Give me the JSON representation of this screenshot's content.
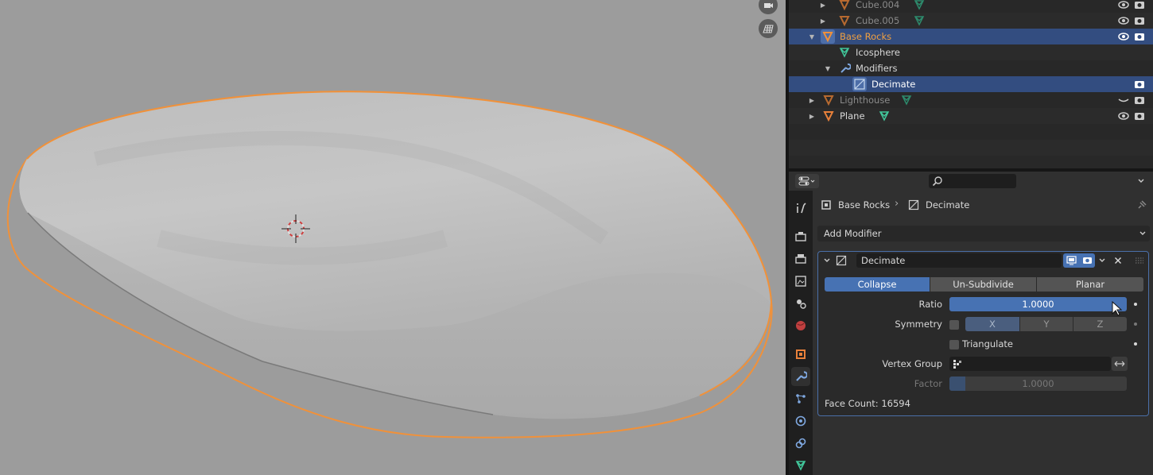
{
  "outliner": {
    "rows": [
      {
        "label": "Cube.004",
        "state": "dim"
      },
      {
        "label": "Cube.005",
        "state": "dim"
      },
      {
        "label": "Base Rocks",
        "state": "selected-active"
      },
      {
        "label": "Icosphere",
        "state": "child"
      },
      {
        "label": "Modifiers",
        "state": "child"
      },
      {
        "label": "Decimate",
        "state": "selected"
      },
      {
        "label": "Lighthouse",
        "state": "dim"
      },
      {
        "label": "Plane",
        "state": "normal"
      }
    ]
  },
  "properties": {
    "search_placeholder": "",
    "breadcrumb": {
      "object": "Base Rocks",
      "modifier": "Decimate"
    },
    "add_modifier_label": "Add Modifier",
    "modifier": {
      "name": "Decimate",
      "modes": [
        "Collapse",
        "Un-Subdivide",
        "Planar"
      ],
      "active_mode": "Collapse",
      "ratio_label": "Ratio",
      "ratio_value": "1.0000",
      "symmetry_label": "Symmetry",
      "symmetry_checked": false,
      "axes": [
        "X",
        "Y",
        "Z"
      ],
      "active_axis": "X",
      "triangulate_label": "Triangulate",
      "triangulate_checked": false,
      "vertex_group_label": "Vertex Group",
      "vertex_group_value": "",
      "factor_label": "Factor",
      "factor_value": "1.0000",
      "face_count": "Face Count: 16594"
    }
  },
  "colors": {
    "accent": "#4772b3",
    "selection": "#334d80",
    "outline": "#f2932d",
    "mesh_green": "#41c79b",
    "object_orange": "#e8803a"
  },
  "icons": {
    "viewport": [
      "camera-icon",
      "grid-icon",
      "3d-cursor-icon"
    ],
    "tabs": [
      "tool-icon",
      "render-icon",
      "output-icon",
      "view-layer-icon",
      "scene-icon",
      "world-icon",
      "object-icon",
      "modifier-wrench-icon",
      "particles-icon",
      "physics-icon",
      "constraints-icon",
      "data-icon"
    ]
  }
}
